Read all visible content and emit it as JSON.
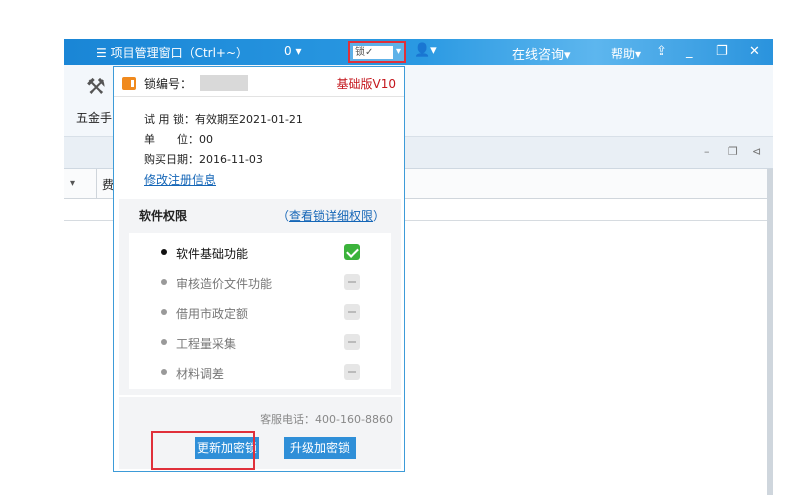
{
  "titlebar": {
    "menu_icon": "list-icon",
    "project_window": "☰ 项目管理窗口（Ctrl+~）",
    "zero_value": "0 ▾",
    "lock_value": "锁✓",
    "online": "在线咨询▾",
    "help": "帮助▾"
  },
  "toolbar": {
    "tool_label": "五金手",
    "tool_icon": "wrench-hammer-icon"
  },
  "grid": {
    "col_header": "费"
  },
  "lock_popup": {
    "lock_no_label": "锁编号：",
    "edition": "基础版V10",
    "trial_label": "试 用 锁：有效期至2021-01-21",
    "unit_label": "单　　位：00",
    "purchase_label": "购买日期：2016-11-03",
    "edit_link": "修改注册信息",
    "permissions_title": "软件权限",
    "permissions_link": "查看锁详细权限",
    "permissions": [
      {
        "label": "软件基础功能",
        "enabled": true
      },
      {
        "label": "审核造价文件功能",
        "enabled": false
      },
      {
        "label": "借用市政定额",
        "enabled": false
      },
      {
        "label": "工程量采集",
        "enabled": false
      },
      {
        "label": "材料调差",
        "enabled": false
      }
    ],
    "phone": "客服电话：400-160-8860",
    "renew_button": "更新加密锁",
    "upgrade_button": "升级加密锁"
  },
  "colors": {
    "accent": "#2f8fd8",
    "highlight": "#e0303a",
    "edition": "#c4161c",
    "check": "#3bb33b"
  }
}
